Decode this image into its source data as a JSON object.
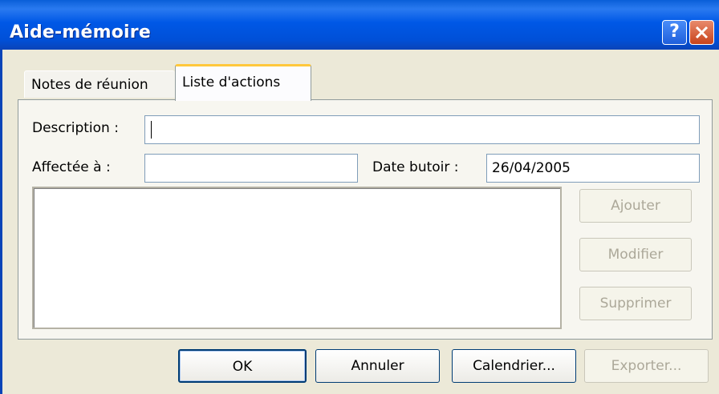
{
  "window": {
    "title": "Aide-mémoire"
  },
  "titlebar": {
    "help_label": "?"
  },
  "tabs": [
    {
      "label": "Notes de réunion",
      "active": false
    },
    {
      "label": "Liste d'actions",
      "active": true
    }
  ],
  "form": {
    "description_label": "Description :",
    "description_value": "",
    "assigned_label": "Affectée à :",
    "assigned_value": "",
    "due_label": "Date butoir :",
    "due_value": "26/04/2005"
  },
  "list_buttons": {
    "add": "Ajouter",
    "modify": "Modifier",
    "delete": "Supprimer"
  },
  "footer_buttons": {
    "ok": "OK",
    "cancel": "Annuler",
    "calendar": "Calendrier...",
    "export": "Exporter..."
  }
}
